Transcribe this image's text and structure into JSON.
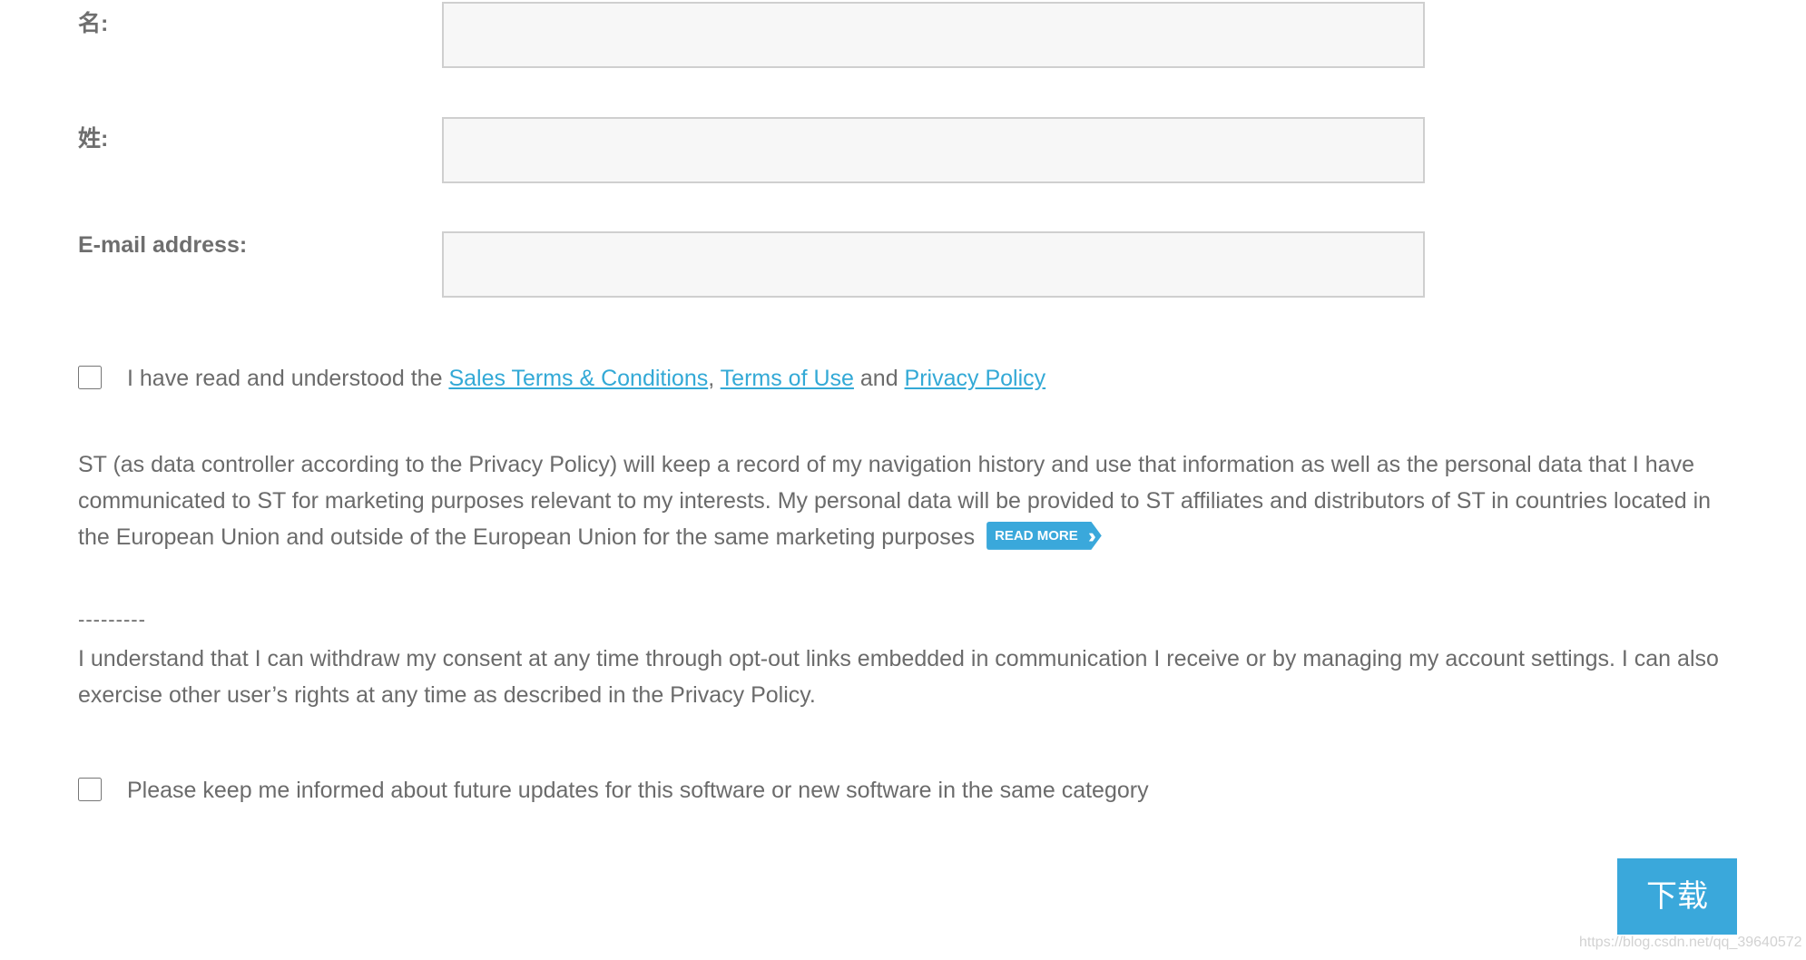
{
  "form": {
    "first_name": {
      "label": "名:",
      "value": ""
    },
    "last_name": {
      "label": "姓:",
      "value": ""
    },
    "email": {
      "label": "E-mail address:",
      "value": ""
    },
    "terms": {
      "prefix": "I have read and understood the ",
      "link1": "Sales Terms & Conditions",
      "sep1": ", ",
      "link2": "Terms of Use",
      "sep2": " and ",
      "link3": "Privacy Policy",
      "checked": false
    },
    "privacy_paragraph": "ST (as data controller according to the Privacy Policy) will keep a record of my navigation history and use that information as well as the personal data that I have communicated to ST for marketing purposes relevant to my interests. My personal data will be provided to ST affiliates and distributors of ST in countries located in the European Union and outside of the European Union for the same marketing purposes",
    "read_more_label": "READ MORE",
    "read_more_icon": "double-chevron-right-icon",
    "divider": "---------",
    "withdraw_paragraph": "I understand that I can withdraw my consent at any time through opt-out links embedded in communication I receive or by managing my account settings. I can also exercise other user’s rights at any time as described in the Privacy Policy.",
    "updates": {
      "label": "Please keep me informed about future updates for this software or new software in the same category",
      "checked": false
    },
    "download_label": "下载"
  },
  "watermark": "https://blog.csdn.net/qq_39640572",
  "colors": {
    "accent": "#3aa8db",
    "link": "#33a9d6",
    "text": "#6b6b6b",
    "field_bg": "#f7f7f7",
    "field_border": "#cfcfcf"
  }
}
